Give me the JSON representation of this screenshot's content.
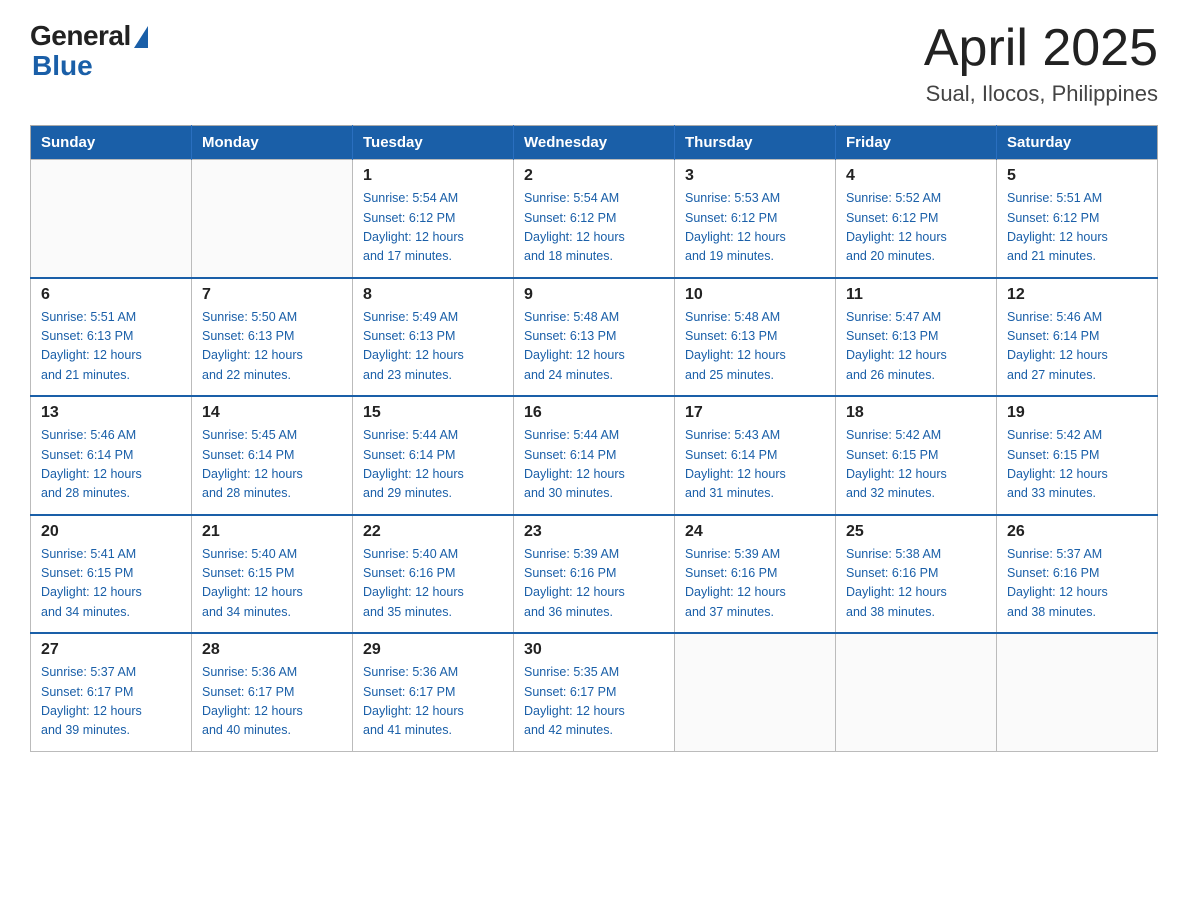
{
  "header": {
    "logo_general": "General",
    "logo_blue": "Blue",
    "title": "April 2025",
    "subtitle": "Sual, Ilocos, Philippines"
  },
  "days_of_week": [
    "Sunday",
    "Monday",
    "Tuesday",
    "Wednesday",
    "Thursday",
    "Friday",
    "Saturday"
  ],
  "weeks": [
    [
      {
        "day": "",
        "info": ""
      },
      {
        "day": "",
        "info": ""
      },
      {
        "day": "1",
        "info": "Sunrise: 5:54 AM\nSunset: 6:12 PM\nDaylight: 12 hours\nand 17 minutes."
      },
      {
        "day": "2",
        "info": "Sunrise: 5:54 AM\nSunset: 6:12 PM\nDaylight: 12 hours\nand 18 minutes."
      },
      {
        "day": "3",
        "info": "Sunrise: 5:53 AM\nSunset: 6:12 PM\nDaylight: 12 hours\nand 19 minutes."
      },
      {
        "day": "4",
        "info": "Sunrise: 5:52 AM\nSunset: 6:12 PM\nDaylight: 12 hours\nand 20 minutes."
      },
      {
        "day": "5",
        "info": "Sunrise: 5:51 AM\nSunset: 6:12 PM\nDaylight: 12 hours\nand 21 minutes."
      }
    ],
    [
      {
        "day": "6",
        "info": "Sunrise: 5:51 AM\nSunset: 6:13 PM\nDaylight: 12 hours\nand 21 minutes."
      },
      {
        "day": "7",
        "info": "Sunrise: 5:50 AM\nSunset: 6:13 PM\nDaylight: 12 hours\nand 22 minutes."
      },
      {
        "day": "8",
        "info": "Sunrise: 5:49 AM\nSunset: 6:13 PM\nDaylight: 12 hours\nand 23 minutes."
      },
      {
        "day": "9",
        "info": "Sunrise: 5:48 AM\nSunset: 6:13 PM\nDaylight: 12 hours\nand 24 minutes."
      },
      {
        "day": "10",
        "info": "Sunrise: 5:48 AM\nSunset: 6:13 PM\nDaylight: 12 hours\nand 25 minutes."
      },
      {
        "day": "11",
        "info": "Sunrise: 5:47 AM\nSunset: 6:13 PM\nDaylight: 12 hours\nand 26 minutes."
      },
      {
        "day": "12",
        "info": "Sunrise: 5:46 AM\nSunset: 6:14 PM\nDaylight: 12 hours\nand 27 minutes."
      }
    ],
    [
      {
        "day": "13",
        "info": "Sunrise: 5:46 AM\nSunset: 6:14 PM\nDaylight: 12 hours\nand 28 minutes."
      },
      {
        "day": "14",
        "info": "Sunrise: 5:45 AM\nSunset: 6:14 PM\nDaylight: 12 hours\nand 28 minutes."
      },
      {
        "day": "15",
        "info": "Sunrise: 5:44 AM\nSunset: 6:14 PM\nDaylight: 12 hours\nand 29 minutes."
      },
      {
        "day": "16",
        "info": "Sunrise: 5:44 AM\nSunset: 6:14 PM\nDaylight: 12 hours\nand 30 minutes."
      },
      {
        "day": "17",
        "info": "Sunrise: 5:43 AM\nSunset: 6:14 PM\nDaylight: 12 hours\nand 31 minutes."
      },
      {
        "day": "18",
        "info": "Sunrise: 5:42 AM\nSunset: 6:15 PM\nDaylight: 12 hours\nand 32 minutes."
      },
      {
        "day": "19",
        "info": "Sunrise: 5:42 AM\nSunset: 6:15 PM\nDaylight: 12 hours\nand 33 minutes."
      }
    ],
    [
      {
        "day": "20",
        "info": "Sunrise: 5:41 AM\nSunset: 6:15 PM\nDaylight: 12 hours\nand 34 minutes."
      },
      {
        "day": "21",
        "info": "Sunrise: 5:40 AM\nSunset: 6:15 PM\nDaylight: 12 hours\nand 34 minutes."
      },
      {
        "day": "22",
        "info": "Sunrise: 5:40 AM\nSunset: 6:16 PM\nDaylight: 12 hours\nand 35 minutes."
      },
      {
        "day": "23",
        "info": "Sunrise: 5:39 AM\nSunset: 6:16 PM\nDaylight: 12 hours\nand 36 minutes."
      },
      {
        "day": "24",
        "info": "Sunrise: 5:39 AM\nSunset: 6:16 PM\nDaylight: 12 hours\nand 37 minutes."
      },
      {
        "day": "25",
        "info": "Sunrise: 5:38 AM\nSunset: 6:16 PM\nDaylight: 12 hours\nand 38 minutes."
      },
      {
        "day": "26",
        "info": "Sunrise: 5:37 AM\nSunset: 6:16 PM\nDaylight: 12 hours\nand 38 minutes."
      }
    ],
    [
      {
        "day": "27",
        "info": "Sunrise: 5:37 AM\nSunset: 6:17 PM\nDaylight: 12 hours\nand 39 minutes."
      },
      {
        "day": "28",
        "info": "Sunrise: 5:36 AM\nSunset: 6:17 PM\nDaylight: 12 hours\nand 40 minutes."
      },
      {
        "day": "29",
        "info": "Sunrise: 5:36 AM\nSunset: 6:17 PM\nDaylight: 12 hours\nand 41 minutes."
      },
      {
        "day": "30",
        "info": "Sunrise: 5:35 AM\nSunset: 6:17 PM\nDaylight: 12 hours\nand 42 minutes."
      },
      {
        "day": "",
        "info": ""
      },
      {
        "day": "",
        "info": ""
      },
      {
        "day": "",
        "info": ""
      }
    ]
  ]
}
